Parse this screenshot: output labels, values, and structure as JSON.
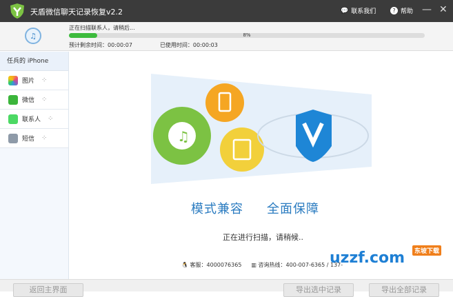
{
  "title": "天盾微信聊天记录恢复v2.2",
  "header": {
    "contact": "联系我们",
    "help": "帮助",
    "minimize": "—",
    "close": "✕"
  },
  "scan": {
    "status": "正在扫描联系人，请稍后...",
    "progress_percent": 8,
    "progress_label": "8%",
    "remaining": "预计剩余时间：00:00:07",
    "elapsed": "已使用时间：00:00:03"
  },
  "sidebar": {
    "device": "任兵的 iPhone",
    "items": [
      {
        "label": "图片",
        "color": "#f5a623"
      },
      {
        "label": "微信",
        "color": "#3bb53b"
      },
      {
        "label": "联系人",
        "color": "#4cd964"
      },
      {
        "label": "短信",
        "color": "#8e9aa8"
      }
    ]
  },
  "main": {
    "slogan1": "模式兼容",
    "slogan2": "全面保障",
    "scanning": "正在进行扫描，请稍候..",
    "service": "客服：4000076365",
    "hotline": "咨询热线：400-007-6365 / 137-"
  },
  "footer": {
    "back": "返回主界面",
    "export_selected": "导出选中记录",
    "export_all": "导出全部记录"
  },
  "watermark": {
    "text": "uzzf.com",
    "tag": "东坡下载"
  }
}
